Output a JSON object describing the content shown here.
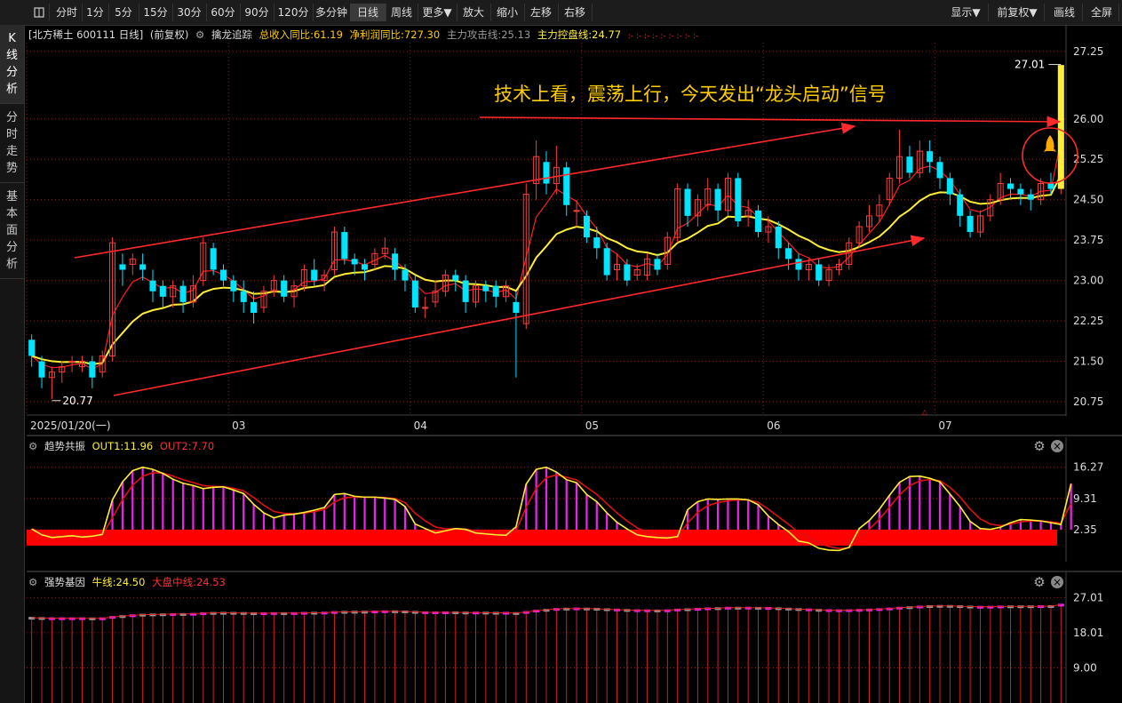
{
  "toolbar": {
    "items": [
      "分时",
      "1分",
      "5分",
      "15分",
      "30分",
      "60分",
      "90分",
      "120分",
      "多分钟",
      "日线",
      "周线",
      "更多▼",
      "放大",
      "缩小",
      "左移",
      "右移"
    ],
    "active": "日线",
    "right_items": [
      "显示▼",
      "前复权▼",
      "画线",
      "全屏"
    ]
  },
  "sidebar": [
    {
      "label": "K线分析",
      "active": true
    },
    {
      "label": "分时走势",
      "active": false
    },
    {
      "label": "基本面分析",
      "active": false
    }
  ],
  "main_info": {
    "stock": "[北方稀土 600111 日线]",
    "adjust": "(前复权)",
    "indicator": "擒龙追踪",
    "revenue_label": "总收入同比:61.19",
    "profit_label": "净利润同比:727.30",
    "attack_label": "主力攻击线:25.13",
    "control_label": "主力控盘线:24.77",
    "dots": ":- :- :- :- :- :- :- :- :-"
  },
  "colors": {
    "up": "#ff3b3b",
    "down": "#00e5ff",
    "ma_fast": "#ff2020",
    "ma_slow": "#ffee33",
    "grid": "#7a1f1f",
    "annotation": "#ffcc00",
    "arrow": "#ff2a2a",
    "magenta": "#ee22ee"
  },
  "annotation": {
    "text": "技术上看，震荡上行，今天发出“龙头启动”信号"
  },
  "rocket_icon": "rocket-icon",
  "sub1_info": {
    "name": "趋势共振",
    "out1": "OUT1:11.96",
    "out2": "OUT2:7.70"
  },
  "sub2_info": {
    "name": "强势基因",
    "bull": "牛线:24.50",
    "market": "大盘中线:24.53"
  },
  "chart_data": [
    {
      "type": "candlestick",
      "title": "北方稀土 600111 日线",
      "ylim": [
        20.6,
        27.4
      ],
      "y_ticks": [
        "27.25",
        "26.00",
        "25.25",
        "24.50",
        "23.75",
        "23.00",
        "22.25",
        "21.50",
        "20.75"
      ],
      "x_labels": [
        "2025/01/20(一)",
        "03",
        "04",
        "05",
        "06",
        "07"
      ],
      "x_label_index": [
        0,
        20,
        38,
        55,
        73,
        90
      ],
      "high_marker": "27.01",
      "low_marker": "20.77",
      "candles": [
        [
          21.9,
          21.6,
          22.0,
          21.4
        ],
        [
          21.5,
          21.2,
          21.6,
          21.0
        ],
        [
          21.2,
          21.3,
          21.4,
          20.8
        ],
        [
          21.3,
          21.4,
          21.5,
          21.1
        ],
        [
          21.5,
          21.5,
          21.6,
          21.3
        ],
        [
          21.4,
          21.5,
          21.6,
          21.3
        ],
        [
          21.5,
          21.2,
          21.6,
          21.0
        ],
        [
          21.3,
          21.6,
          21.7,
          21.2
        ],
        [
          21.6,
          23.7,
          23.8,
          21.5
        ],
        [
          23.3,
          23.2,
          23.5,
          22.9
        ],
        [
          23.3,
          23.4,
          23.5,
          23.1
        ],
        [
          23.3,
          23.2,
          23.5,
          23.0
        ],
        [
          23.0,
          22.8,
          23.2,
          22.6
        ],
        [
          22.9,
          22.7,
          23.0,
          22.5
        ],
        [
          22.7,
          22.9,
          23.0,
          22.5
        ],
        [
          22.9,
          22.6,
          23.0,
          22.4
        ],
        [
          22.6,
          22.9,
          23.1,
          22.5
        ],
        [
          23.0,
          23.7,
          23.8,
          22.9
        ],
        [
          23.6,
          23.2,
          23.7,
          23.1
        ],
        [
          23.2,
          23.0,
          23.3,
          22.9
        ],
        [
          23.0,
          22.8,
          23.1,
          22.6
        ],
        [
          22.8,
          22.6,
          23.0,
          22.4
        ],
        [
          22.6,
          22.4,
          22.8,
          22.2
        ],
        [
          22.5,
          22.8,
          22.9,
          22.4
        ],
        [
          22.8,
          23.0,
          23.1,
          22.7
        ],
        [
          23.0,
          22.7,
          23.1,
          22.6
        ],
        [
          22.7,
          22.9,
          23.0,
          22.5
        ],
        [
          22.9,
          23.2,
          23.3,
          22.8
        ],
        [
          23.2,
          23.0,
          23.4,
          22.9
        ],
        [
          23.0,
          23.1,
          23.2,
          22.8
        ],
        [
          23.2,
          23.9,
          24.0,
          23.1
        ],
        [
          23.9,
          23.4,
          24.0,
          23.3
        ],
        [
          23.4,
          23.3,
          23.5,
          23.1
        ],
        [
          23.3,
          23.2,
          23.4,
          23.0
        ],
        [
          23.3,
          23.5,
          23.6,
          23.2
        ],
        [
          23.5,
          23.6,
          23.8,
          23.4
        ],
        [
          23.5,
          23.2,
          23.6,
          23.0
        ],
        [
          23.2,
          23.0,
          23.3,
          22.8
        ],
        [
          23.0,
          22.5,
          23.1,
          22.4
        ],
        [
          22.5,
          22.5,
          22.7,
          22.3
        ],
        [
          22.6,
          22.8,
          23.0,
          22.5
        ],
        [
          22.8,
          23.1,
          23.2,
          22.7
        ],
        [
          23.1,
          23.0,
          23.2,
          22.8
        ],
        [
          23.0,
          22.6,
          23.1,
          22.4
        ],
        [
          22.6,
          22.9,
          23.0,
          22.5
        ],
        [
          22.9,
          22.8,
          23.0,
          22.6
        ],
        [
          22.9,
          22.7,
          23.0,
          22.5
        ],
        [
          22.7,
          22.9,
          23.0,
          22.6
        ],
        [
          22.6,
          22.4,
          22.8,
          21.2
        ],
        [
          22.2,
          24.6,
          24.8,
          22.1
        ],
        [
          24.8,
          25.3,
          25.6,
          24.5
        ],
        [
          25.2,
          24.8,
          25.4,
          24.6
        ],
        [
          24.8,
          25.1,
          25.5,
          24.6
        ],
        [
          25.1,
          24.4,
          25.2,
          24.2
        ],
        [
          24.3,
          24.3,
          24.5,
          24.0
        ],
        [
          24.2,
          23.8,
          24.3,
          23.7
        ],
        [
          23.8,
          23.6,
          24.0,
          23.4
        ],
        [
          23.6,
          23.1,
          23.7,
          23.0
        ],
        [
          23.2,
          23.3,
          23.5,
          23.0
        ],
        [
          23.3,
          23.0,
          23.4,
          22.9
        ],
        [
          23.1,
          23.2,
          23.3,
          23.0
        ],
        [
          23.1,
          23.4,
          23.5,
          23.0
        ],
        [
          23.4,
          23.2,
          23.5,
          23.1
        ],
        [
          23.3,
          23.8,
          23.9,
          23.2
        ],
        [
          23.8,
          24.7,
          24.8,
          23.7
        ],
        [
          24.7,
          24.2,
          24.8,
          24.0
        ],
        [
          24.2,
          24.5,
          24.6,
          24.0
        ],
        [
          24.4,
          24.7,
          24.9,
          24.3
        ],
        [
          24.7,
          24.3,
          24.8,
          24.1
        ],
        [
          24.3,
          24.9,
          25.0,
          24.2
        ],
        [
          24.9,
          24.1,
          25.0,
          24.0
        ],
        [
          24.2,
          24.3,
          24.5,
          24.0
        ],
        [
          24.3,
          23.9,
          24.4,
          23.8
        ],
        [
          23.9,
          24.0,
          24.2,
          23.7
        ],
        [
          24.0,
          23.6,
          24.1,
          23.4
        ],
        [
          23.6,
          23.4,
          23.7,
          23.2
        ],
        [
          23.4,
          23.2,
          23.5,
          23.0
        ],
        [
          23.2,
          23.3,
          23.4,
          23.0
        ],
        [
          23.3,
          23.0,
          23.4,
          22.9
        ],
        [
          23.0,
          23.2,
          23.3,
          22.9
        ],
        [
          23.2,
          23.3,
          23.4,
          23.1
        ],
        [
          23.3,
          23.7,
          23.8,
          23.2
        ],
        [
          23.7,
          24.0,
          24.1,
          23.6
        ],
        [
          24.0,
          24.2,
          24.4,
          23.9
        ],
        [
          24.2,
          24.4,
          24.6,
          24.1
        ],
        [
          24.5,
          24.9,
          25.0,
          24.4
        ],
        [
          24.9,
          25.3,
          25.8,
          24.8
        ],
        [
          25.3,
          25.0,
          25.5,
          24.9
        ],
        [
          25.0,
          25.4,
          25.6,
          24.9
        ],
        [
          25.4,
          25.2,
          25.6,
          25.0
        ],
        [
          25.2,
          24.9,
          25.3,
          24.7
        ],
        [
          24.9,
          24.6,
          25.0,
          24.4
        ],
        [
          24.6,
          24.2,
          24.7,
          24.0
        ],
        [
          24.2,
          23.9,
          24.3,
          23.8
        ],
        [
          23.9,
          24.2,
          24.3,
          23.8
        ],
        [
          24.2,
          24.5,
          24.6,
          24.1
        ],
        [
          24.5,
          24.8,
          25.0,
          24.4
        ],
        [
          24.8,
          24.7,
          24.9,
          24.5
        ],
        [
          24.7,
          24.6,
          24.8,
          24.4
        ],
        [
          24.6,
          24.5,
          24.7,
          24.3
        ],
        [
          24.5,
          24.8,
          24.9,
          24.4
        ],
        [
          24.8,
          24.7,
          25.0,
          24.6
        ],
        [
          24.7,
          27.0,
          27.0,
          24.6
        ]
      ],
      "series": [
        {
          "name": "主力攻击线",
          "values": []
        },
        {
          "name": "主力控盘线",
          "values": []
        }
      ]
    },
    {
      "type": "bar",
      "title": "趋势共振",
      "ylim": [
        -4,
        18
      ],
      "y_ticks": [
        "16.27",
        "9.31",
        "2.35"
      ],
      "series": [
        {
          "name": "OUT1",
          "values": [
            2.5,
            1.2,
            0.6,
            0.8,
            1.0,
            0.7,
            0.9,
            1.3,
            9.0,
            13.0,
            15.5,
            16.27,
            15.8,
            14.9,
            13.6,
            12.7,
            12.2,
            11.5,
            11.8,
            11.9,
            11.2,
            10.4,
            8.0,
            6.1,
            5.0,
            5.6,
            5.8,
            6.2,
            6.7,
            7.3,
            10.2,
            10.4,
            9.8,
            9.6,
            9.6,
            9.4,
            9.1,
            7.5,
            3.6,
            2.6,
            1.6,
            2.1,
            2.6,
            2.4,
            1.6,
            1.4,
            1.2,
            1.1,
            3.0,
            12.5,
            15.8,
            16.27,
            15.2,
            13.5,
            12.8,
            10.2,
            8.6,
            6.1,
            4.0,
            2.5,
            1.2,
            0.8,
            0.6,
            0.5,
            0.8,
            6.8,
            8.6,
            9.2,
            9.1,
            9.2,
            9.2,
            9.0,
            7.9,
            5.4,
            3.5,
            1.9,
            -0.2,
            -0.6,
            -1.8,
            -2.2,
            -2.3,
            -1.6,
            2.6,
            4.4,
            6.9,
            10.0,
            12.9,
            14.2,
            14.3,
            13.8,
            13.0,
            10.3,
            7.5,
            4.2,
            2.6,
            2.4,
            2.9,
            3.9,
            4.6,
            4.5,
            4.3,
            3.9,
            3.5,
            12.6
          ]
        },
        {
          "name": "OUT2",
          "values": []
        }
      ]
    },
    {
      "type": "bar",
      "title": "强势基因",
      "ylim": [
        0,
        28
      ],
      "y_ticks": [
        "27.01",
        "18.01",
        "9.00"
      ],
      "series": [
        {
          "name": "牛线",
          "values": []
        },
        {
          "name": "大盘中线",
          "values": []
        }
      ]
    }
  ]
}
